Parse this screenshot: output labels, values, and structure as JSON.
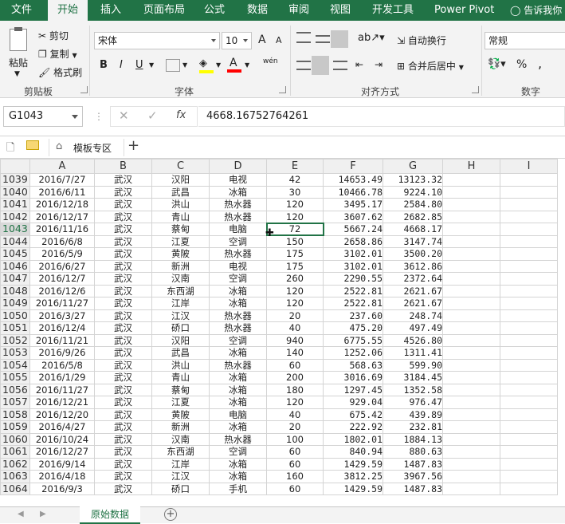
{
  "ribbon_tabs": [
    "文件",
    "开始",
    "插入",
    "页面布局",
    "公式",
    "数据",
    "审阅",
    "视图",
    "开发工具",
    "Power Pivot"
  ],
  "active_tab": "开始",
  "tell_me": "告诉我你",
  "clipboard": {
    "paste": "粘贴",
    "cut": "剪切",
    "copy": "复制",
    "format_painter": "格式刷",
    "group_label": "剪贴板"
  },
  "font": {
    "name": "宋体",
    "size": "10",
    "grow": "A",
    "shrink": "A",
    "bold": "B",
    "italic": "I",
    "underline": "U",
    "phonetic": "wén",
    "group_label": "字体",
    "fill_color": "#ffff00",
    "font_color": "#ff0000"
  },
  "alignment": {
    "wrap_text": "自动换行",
    "merge_center": "合并后居中",
    "group_label": "对齐方式"
  },
  "number": {
    "format": "常规",
    "percent": "%",
    "comma": ",",
    "group_label": "数字"
  },
  "name_box": "G1043",
  "fx": "fx",
  "formula_value": "4668.16752764261",
  "template_zone": "模板专区",
  "columns": [
    "A",
    "B",
    "C",
    "D",
    "E",
    "F",
    "G",
    "H",
    "I"
  ],
  "selected_column": "G",
  "selected_row": "1043",
  "rows": [
    {
      "n": "1039",
      "a": "2016/7/27",
      "b": "武汉",
      "c": "汉阳",
      "d": "电视",
      "e": "42",
      "f": "14653.49",
      "g": "13123.32"
    },
    {
      "n": "1040",
      "a": "2016/6/11",
      "b": "武汉",
      "c": "武昌",
      "d": "冰箱",
      "e": "30",
      "f": "10466.78",
      "g": "9224.10"
    },
    {
      "n": "1041",
      "a": "2016/12/18",
      "b": "武汉",
      "c": "洪山",
      "d": "热水器",
      "e": "120",
      "f": "3495.17",
      "g": "2584.80"
    },
    {
      "n": "1042",
      "a": "2016/12/17",
      "b": "武汉",
      "c": "青山",
      "d": "热水器",
      "e": "120",
      "f": "3607.62",
      "g": "2682.85"
    },
    {
      "n": "1043",
      "a": "2016/11/16",
      "b": "武汉",
      "c": "蔡甸",
      "d": "电脑",
      "e": "72",
      "f": "5667.24",
      "g": "4668.17"
    },
    {
      "n": "1044",
      "a": "2016/6/8",
      "b": "武汉",
      "c": "江夏",
      "d": "空调",
      "e": "150",
      "f": "2658.86",
      "g": "3147.74"
    },
    {
      "n": "1045",
      "a": "2016/5/9",
      "b": "武汉",
      "c": "黄陂",
      "d": "热水器",
      "e": "175",
      "f": "3102.01",
      "g": "3500.20"
    },
    {
      "n": "1046",
      "a": "2016/6/27",
      "b": "武汉",
      "c": "新洲",
      "d": "电视",
      "e": "175",
      "f": "3102.01",
      "g": "3612.86"
    },
    {
      "n": "1047",
      "a": "2016/12/7",
      "b": "武汉",
      "c": "汉南",
      "d": "空调",
      "e": "260",
      "f": "2290.55",
      "g": "2372.64"
    },
    {
      "n": "1048",
      "a": "2016/12/6",
      "b": "武汉",
      "c": "东西湖",
      "d": "冰箱",
      "e": "120",
      "f": "2522.81",
      "g": "2621.67"
    },
    {
      "n": "1049",
      "a": "2016/11/27",
      "b": "武汉",
      "c": "江岸",
      "d": "冰箱",
      "e": "120",
      "f": "2522.81",
      "g": "2621.67"
    },
    {
      "n": "1050",
      "a": "2016/3/27",
      "b": "武汉",
      "c": "江汉",
      "d": "热水器",
      "e": "20",
      "f": "237.60",
      "g": "248.74"
    },
    {
      "n": "1051",
      "a": "2016/12/4",
      "b": "武汉",
      "c": "硚口",
      "d": "热水器",
      "e": "40",
      "f": "475.20",
      "g": "497.49"
    },
    {
      "n": "1052",
      "a": "2016/11/21",
      "b": "武汉",
      "c": "汉阳",
      "d": "空调",
      "e": "940",
      "f": "6775.55",
      "g": "4526.80"
    },
    {
      "n": "1053",
      "a": "2016/9/26",
      "b": "武汉",
      "c": "武昌",
      "d": "冰箱",
      "e": "140",
      "f": "1252.06",
      "g": "1311.41"
    },
    {
      "n": "1054",
      "a": "2016/5/8",
      "b": "武汉",
      "c": "洪山",
      "d": "热水器",
      "e": "60",
      "f": "568.63",
      "g": "599.90"
    },
    {
      "n": "1055",
      "a": "2016/1/29",
      "b": "武汉",
      "c": "青山",
      "d": "冰箱",
      "e": "200",
      "f": "3016.69",
      "g": "3184.45"
    },
    {
      "n": "1056",
      "a": "2016/11/27",
      "b": "武汉",
      "c": "蔡甸",
      "d": "冰箱",
      "e": "180",
      "f": "1297.45",
      "g": "1352.58"
    },
    {
      "n": "1057",
      "a": "2016/12/21",
      "b": "武汉",
      "c": "江夏",
      "d": "冰箱",
      "e": "120",
      "f": "929.04",
      "g": "976.47"
    },
    {
      "n": "1058",
      "a": "2016/12/20",
      "b": "武汉",
      "c": "黄陂",
      "d": "电脑",
      "e": "40",
      "f": "675.42",
      "g": "439.89"
    },
    {
      "n": "1059",
      "a": "2016/4/27",
      "b": "武汉",
      "c": "新洲",
      "d": "冰箱",
      "e": "20",
      "f": "222.92",
      "g": "232.81"
    },
    {
      "n": "1060",
      "a": "2016/10/24",
      "b": "武汉",
      "c": "汉南",
      "d": "热水器",
      "e": "100",
      "f": "1802.01",
      "g": "1884.13"
    },
    {
      "n": "1061",
      "a": "2016/12/27",
      "b": "武汉",
      "c": "东西湖",
      "d": "空调",
      "e": "60",
      "f": "840.94",
      "g": "880.63"
    },
    {
      "n": "1062",
      "a": "2016/9/14",
      "b": "武汉",
      "c": "江岸",
      "d": "冰箱",
      "e": "60",
      "f": "1429.59",
      "g": "1487.83"
    },
    {
      "n": "1063",
      "a": "2016/4/18",
      "b": "武汉",
      "c": "江汉",
      "d": "冰箱",
      "e": "160",
      "f": "3812.25",
      "g": "3967.56"
    },
    {
      "n": "1064",
      "a": "2016/9/3",
      "b": "武汉",
      "c": "硚口",
      "d": "手机",
      "e": "60",
      "f": "1429.59",
      "g": "1487.83"
    }
  ],
  "sheet_tab": "原始数据",
  "accent_color": "#217346"
}
